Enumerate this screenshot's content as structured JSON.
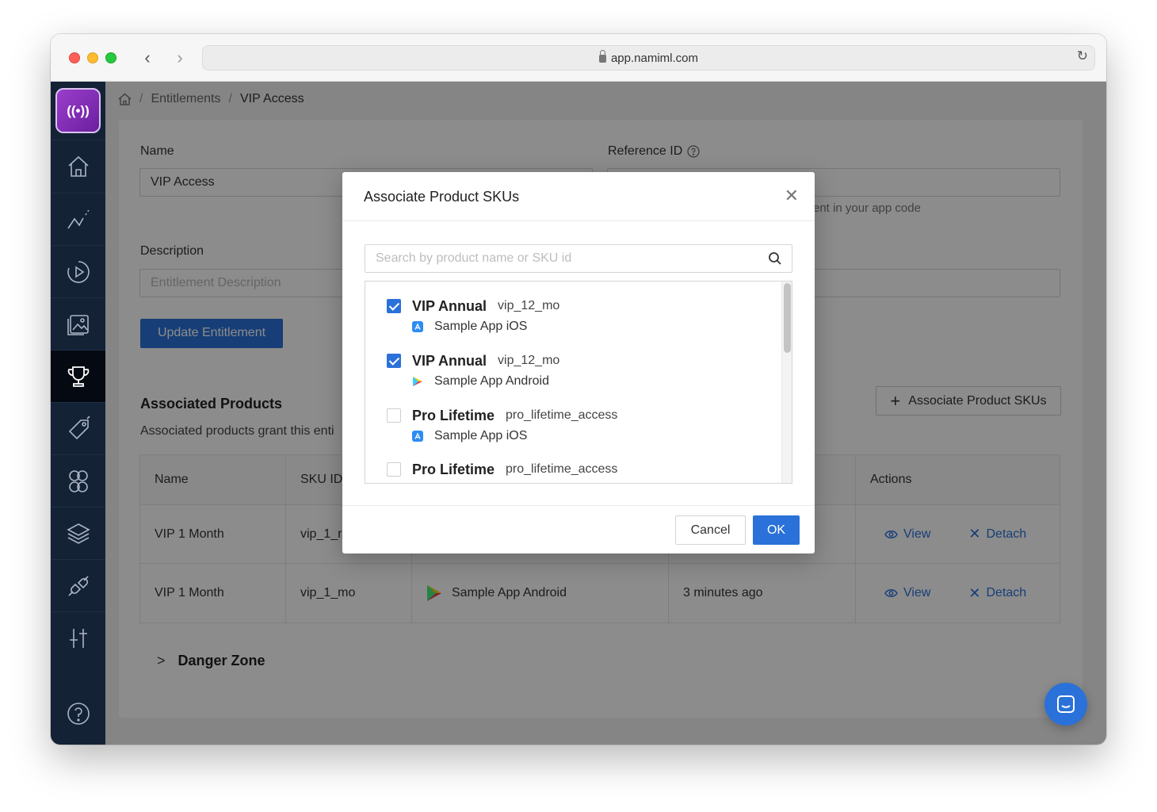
{
  "browser": {
    "url": "app.namiml.com"
  },
  "breadcrumb": {
    "items": [
      "Entitlements",
      "VIP Access"
    ]
  },
  "form": {
    "name_label": "Name",
    "name_value": "VIP Access",
    "reference_label": "Reference ID",
    "reference_hint": "ent in your app code",
    "description_label": "Description",
    "description_placeholder": "Entitlement Description",
    "update_button": "Update Entitlement"
  },
  "associated": {
    "title": "Associated Products",
    "subtitle": "Associated products grant this enti",
    "associate_button": "Associate Product SKUs",
    "columns": [
      "Name",
      "SKU ID",
      "Actions"
    ],
    "rows": [
      {
        "name": "VIP 1 Month",
        "sku": "vip_1_r",
        "app": "",
        "updated": "",
        "view": "View",
        "detach": "Detach"
      },
      {
        "name": "VIP 1 Month",
        "sku": "vip_1_mo",
        "app": "Sample App Android",
        "updated": "3 minutes ago",
        "view": "View",
        "detach": "Detach"
      }
    ]
  },
  "danger_zone": "Danger Zone",
  "modal": {
    "title": "Associate Product SKUs",
    "search_placeholder": "Search by product name or SKU id",
    "items": [
      {
        "name": "VIP Annual",
        "sku": "vip_12_mo",
        "app": "Sample App iOS",
        "platform": "ios-app-icon",
        "checked": true
      },
      {
        "name": "VIP Annual",
        "sku": "vip_12_mo",
        "app": "Sample App Android",
        "platform": "android-play-icon",
        "checked": true
      },
      {
        "name": "Pro Lifetime",
        "sku": "pro_lifetime_access",
        "app": "Sample App iOS",
        "platform": "ios-app-icon",
        "checked": false
      },
      {
        "name": "Pro Lifetime",
        "sku": "pro_lifetime_access",
        "app": "",
        "platform": "",
        "checked": false
      }
    ],
    "cancel": "Cancel",
    "ok": "OK"
  },
  "colors": {
    "accent": "#2a71d9",
    "sidebar": "#142236",
    "logo": "#8a2fc0"
  }
}
